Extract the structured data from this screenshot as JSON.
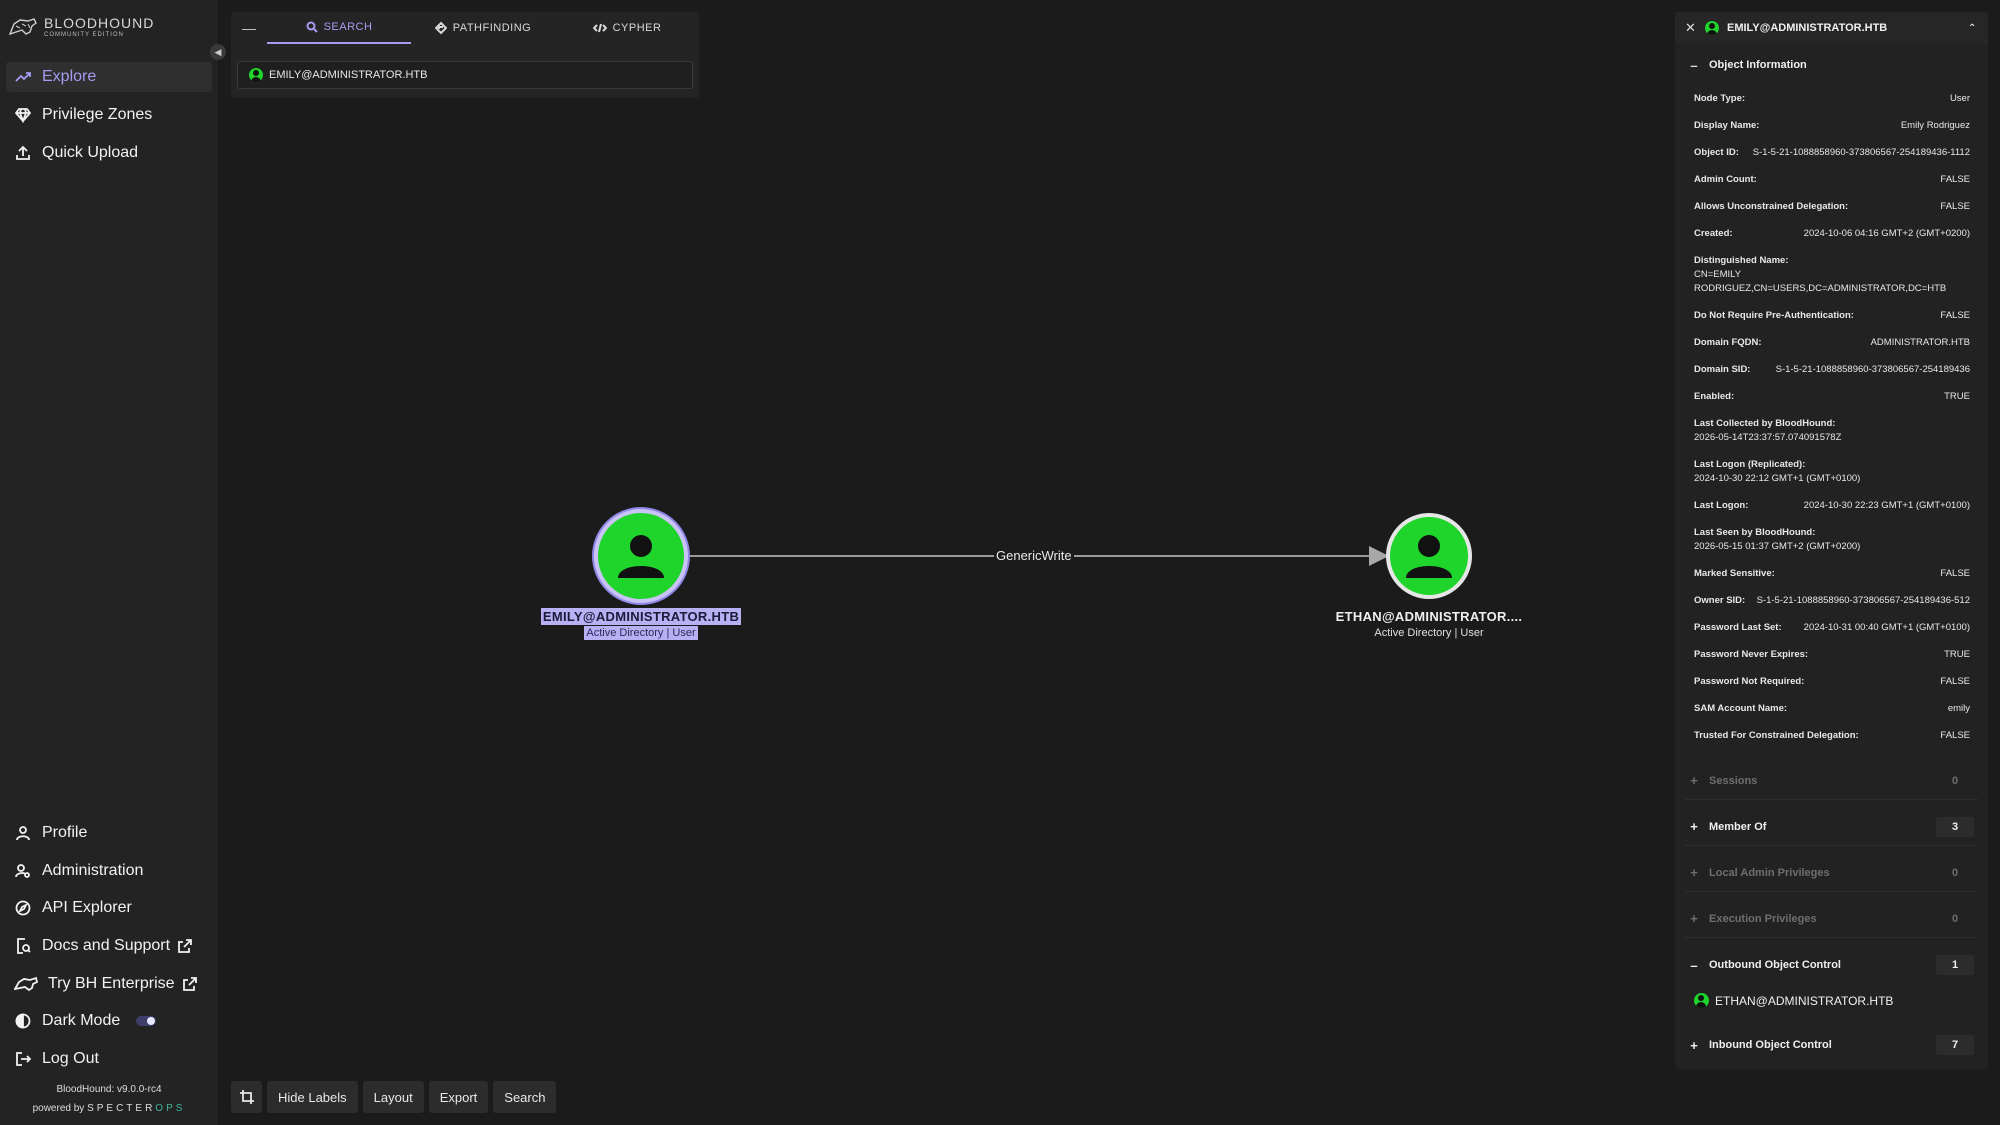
{
  "sidebar": {
    "logo_title": "BLOODHOUND",
    "logo_sub": "COMMUNITY EDITION",
    "top_items": [
      {
        "label": "Explore"
      },
      {
        "label": "Privilege Zones"
      },
      {
        "label": "Quick Upload"
      }
    ],
    "bottom_items": [
      {
        "label": "Profile"
      },
      {
        "label": "Administration"
      },
      {
        "label": "API Explorer"
      },
      {
        "label": "Docs and Support"
      },
      {
        "label": "Try BH Enterprise"
      },
      {
        "label": "Dark Mode"
      },
      {
        "label": "Log Out"
      }
    ],
    "version": "BloodHound: v9.0.0-rc4",
    "powered_by": "powered by",
    "powered_brand": "SPECTER",
    "powered_ops": "OPS"
  },
  "search": {
    "tabs": [
      {
        "label": "SEARCH"
      },
      {
        "label": "PATHFINDING"
      },
      {
        "label": "CYPHER"
      }
    ],
    "value": "EMILY@ADMINISTRATOR.HTB"
  },
  "graph": {
    "source": {
      "name": "EMILY@ADMINISTRATOR.HTB",
      "sub": "Active Directory | User"
    },
    "target": {
      "name": "ETHAN@ADMINISTRATOR....",
      "sub": "Active Directory | User"
    },
    "edge_label": "GenericWrite",
    "colors": {
      "node": "#1fd42a",
      "selection": "#b7b0f3",
      "accent": "#a59cf2"
    }
  },
  "toolbar": {
    "hide_labels": "Hide Labels",
    "layout": "Layout",
    "export": "Export",
    "search": "Search"
  },
  "panel": {
    "title": "EMILY@ADMINISTRATOR.HTB",
    "object_info_title": "Object Information",
    "props": [
      {
        "k": "Node Type:",
        "v": "User"
      },
      {
        "k": "Display Name:",
        "v": "Emily Rodriguez"
      },
      {
        "k": "Object ID:",
        "v": "S-1-5-21-1088858960-373806567-254189436-1112"
      },
      {
        "k": "Admin Count:",
        "v": "FALSE"
      },
      {
        "k": "Allows Unconstrained Delegation:",
        "v": "FALSE"
      },
      {
        "k": "Created:",
        "v": "2024-10-06 04:16 GMT+2 (GMT+0200)"
      },
      {
        "k": "Distinguished Name:",
        "v": "CN=EMILY RODRIGUEZ,CN=USERS,DC=ADMINISTRATOR,DC=HTB"
      },
      {
        "k": "Do Not Require Pre-Authentication:",
        "v": "FALSE"
      },
      {
        "k": "Domain FQDN:",
        "v": "ADMINISTRATOR.HTB"
      },
      {
        "k": "Domain SID:",
        "v": "S-1-5-21-1088858960-373806567-254189436"
      },
      {
        "k": "Enabled:",
        "v": "TRUE"
      },
      {
        "k": "Last Collected by BloodHound:",
        "v": "2026-05-14T23:37:57.074091578Z"
      },
      {
        "k": "Last Logon (Replicated):",
        "v": "2024-10-30 22:12 GMT+1 (GMT+0100)"
      },
      {
        "k": "Last Logon:",
        "v": "2024-10-30 22:23 GMT+1 (GMT+0100)"
      },
      {
        "k": "Last Seen by BloodHound:",
        "v": "2026-05-15 01:37 GMT+2 (GMT+0200)"
      },
      {
        "k": "Marked Sensitive:",
        "v": "FALSE"
      },
      {
        "k": "Owner SID:",
        "v": "S-1-5-21-1088858960-373806567-254189436-512"
      },
      {
        "k": "Password Last Set:",
        "v": "2024-10-31 00:40 GMT+1 (GMT+0100)"
      },
      {
        "k": "Password Never Expires:",
        "v": "TRUE"
      },
      {
        "k": "Password Not Required:",
        "v": "FALSE"
      },
      {
        "k": "SAM Account Name:",
        "v": "emily"
      },
      {
        "k": "Trusted For Constrained Delegation:",
        "v": "FALSE"
      }
    ],
    "sections": [
      {
        "label": "Sessions",
        "count": "0"
      },
      {
        "label": "Member Of",
        "count": "3"
      },
      {
        "label": "Local Admin Privileges",
        "count": "0"
      },
      {
        "label": "Execution Privileges",
        "count": "0"
      },
      {
        "label": "Outbound Object Control",
        "count": "1"
      },
      {
        "label": "Inbound Object Control",
        "count": "7"
      }
    ],
    "outbound_item": "ETHAN@ADMINISTRATOR.HTB"
  }
}
